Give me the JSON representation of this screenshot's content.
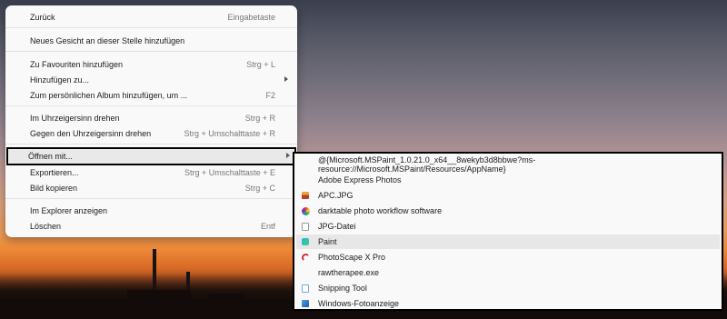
{
  "context_menu": {
    "items": [
      {
        "label": "Zurück",
        "shortcut": "Eingabetaste"
      },
      {
        "label": "Neues Gesicht an dieser Stelle hinzufügen",
        "shortcut": ""
      },
      {
        "label": "Zu Favouriten hinzufügen",
        "shortcut": "Strg + L"
      },
      {
        "label": "Hinzufügen zu...",
        "shortcut": ""
      },
      {
        "label": "Zum persönlichen Album hinzufügen, um ...",
        "shortcut": "F2"
      },
      {
        "label": "Im Uhrzeigersinn drehen",
        "shortcut": "Strg + R"
      },
      {
        "label": "Gegen den Uhrzeigersinn drehen",
        "shortcut": "Strg + Umschalttaste + R"
      },
      {
        "label": "Öffnen mit...",
        "shortcut": ""
      },
      {
        "label": "Exportieren...",
        "shortcut": "Strg + Umschalttaste + E"
      },
      {
        "label": "Bild kopieren",
        "shortcut": "Strg + C"
      },
      {
        "label": "Im Explorer anzeigen",
        "shortcut": ""
      },
      {
        "label": "Löschen",
        "shortcut": "Entf"
      }
    ]
  },
  "open_with_submenu": {
    "items": [
      {
        "label": "@{Microsoft.MSPaint_1.0.21.0_x64__8wekyb3d8bbwe?ms-resource://Microsoft.MSPaint/Resources/AppName}",
        "icon": ""
      },
      {
        "label": "Adobe Express Photos",
        "icon": ""
      },
      {
        "label": "APC.JPG",
        "icon": "apc-icon"
      },
      {
        "label": "darktable photo workflow software",
        "icon": "darktable-icon"
      },
      {
        "label": "JPG-Datei",
        "icon": "jpg-file-icon"
      },
      {
        "label": "Paint",
        "icon": "paint-icon"
      },
      {
        "label": "PhotoScape X Pro",
        "icon": "photoscape-icon"
      },
      {
        "label": "rawtherapee.exe",
        "icon": ""
      },
      {
        "label": "Snipping Tool",
        "icon": "snipping-tool-icon"
      },
      {
        "label": "Windows-Fotoanzeige",
        "icon": "windows-photo-viewer-icon"
      }
    ]
  }
}
